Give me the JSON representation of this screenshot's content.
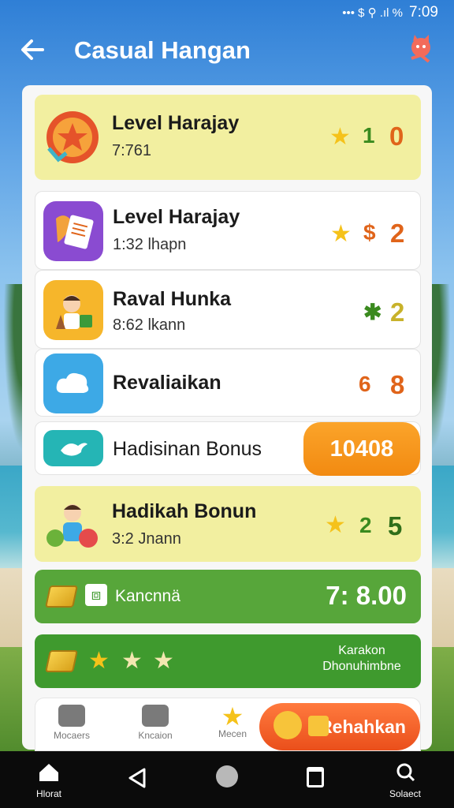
{
  "status_bar": {
    "icons_text": "••• $ ⚲ .ıl %",
    "time": "7:09"
  },
  "header": {
    "title": "Casual Hangan",
    "back_icon": "back-arrow-icon",
    "mascot_icon": "fox-mascot-icon"
  },
  "rows": [
    {
      "title": "Level Harajay",
      "subtitle": "7:761",
      "mid": "1",
      "value": "0",
      "mid_color": "#3a8a1e",
      "value_color": "#e0641a"
    },
    {
      "title": "Level Harajay",
      "subtitle": "1:32 lhapn",
      "mid": "$",
      "value": "2",
      "mid_color": "#e0641a",
      "value_color": "#e0641a"
    },
    {
      "title": "Raval Hunka",
      "subtitle": "8:62 lkann",
      "mid": "✱",
      "value": "2",
      "mid_color": "#3a8a1e",
      "value_color": "#c8b22a"
    },
    {
      "title": "Revaliaikan",
      "subtitle": "",
      "mid": "6",
      "value": "8",
      "mid_color": "#e0641a",
      "value_color": "#e0641a"
    }
  ],
  "bonus_row": {
    "title": "Hadisinan Bonus",
    "value": "10408"
  },
  "bonus_row2": {
    "title": "Hadikah Bonun",
    "subtitle": "3:2 Jnann",
    "mid": "2",
    "value": "5"
  },
  "green_row": {
    "label": "Kancnnä",
    "value": "7: 8.00"
  },
  "green_row2": {
    "line1": "Karakon",
    "line2": "Dhonuhimbne"
  },
  "tabs": [
    {
      "label": "Mocaers"
    },
    {
      "label": "Kncaion"
    },
    {
      "label": "Mecen"
    }
  ],
  "cta": {
    "label": "Rehahkan"
  },
  "navbar": {
    "home_label": "Hlorat",
    "search_label": "Solaect"
  },
  "colors": {
    "accent_orange": "#f28a11",
    "accent_green": "#57a63a",
    "highlight_yellow": "#f2efa0"
  }
}
